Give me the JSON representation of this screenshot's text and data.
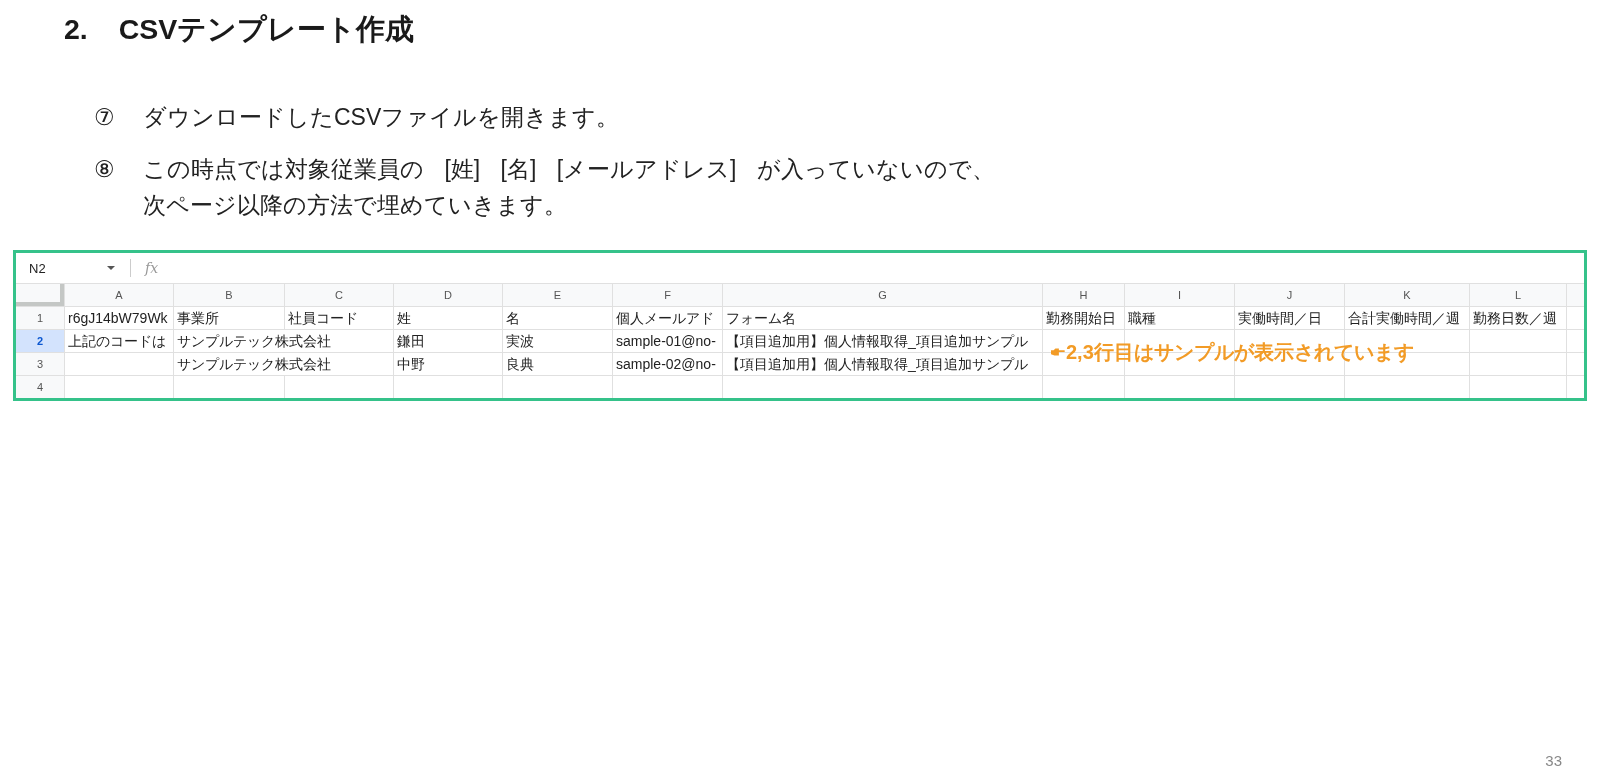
{
  "heading": {
    "number": "2.",
    "title": "CSVテンプレート作成"
  },
  "steps": [
    {
      "marker": "⑦",
      "lines": [
        "ダウンロードしたCSVファイルを開きます。"
      ]
    },
    {
      "marker": "⑧",
      "lines": [
        "この時点では対象従業員の [姓] [名] [メールアドレス] が入っていないので、",
        "次ページ以降の方法で埋めていきます。"
      ]
    }
  ],
  "spreadsheet": {
    "name_box": "N2",
    "formula_label": "fx",
    "columns": [
      "A",
      "B",
      "C",
      "D",
      "E",
      "F",
      "G",
      "H",
      "I",
      "J",
      "K",
      "L"
    ],
    "rows": [
      {
        "header": "1",
        "selected": false,
        "cells": [
          "r6gJ14bW79Wk",
          "事業所",
          "社員コード",
          "姓",
          "名",
          "個人メールアド",
          "フォーム名",
          "勤務開始日",
          "職種",
          "実働時間／日",
          "合計実働時間／週",
          "勤務日数／週"
        ]
      },
      {
        "header": "2",
        "selected": true,
        "cells": [
          "上記のコードは",
          "サンプルテック株式会社",
          null,
          "鎌田",
          "実波",
          "sample-01@no-",
          "【項目追加用】個人情報取得_項目追加サンプル",
          null,
          null,
          null,
          null,
          null
        ]
      },
      {
        "header": "3",
        "selected": false,
        "cells": [
          null,
          "サンプルテック株式会社",
          null,
          "中野",
          "良典",
          "sample-02@no-",
          "【項目追加用】個人情報取得_項目追加サンプル",
          null,
          null,
          null,
          null,
          null
        ]
      },
      {
        "header": "4",
        "selected": false
      }
    ],
    "annotation": "2,3行目はサンプルが表示されています"
  },
  "page_number": "33"
}
